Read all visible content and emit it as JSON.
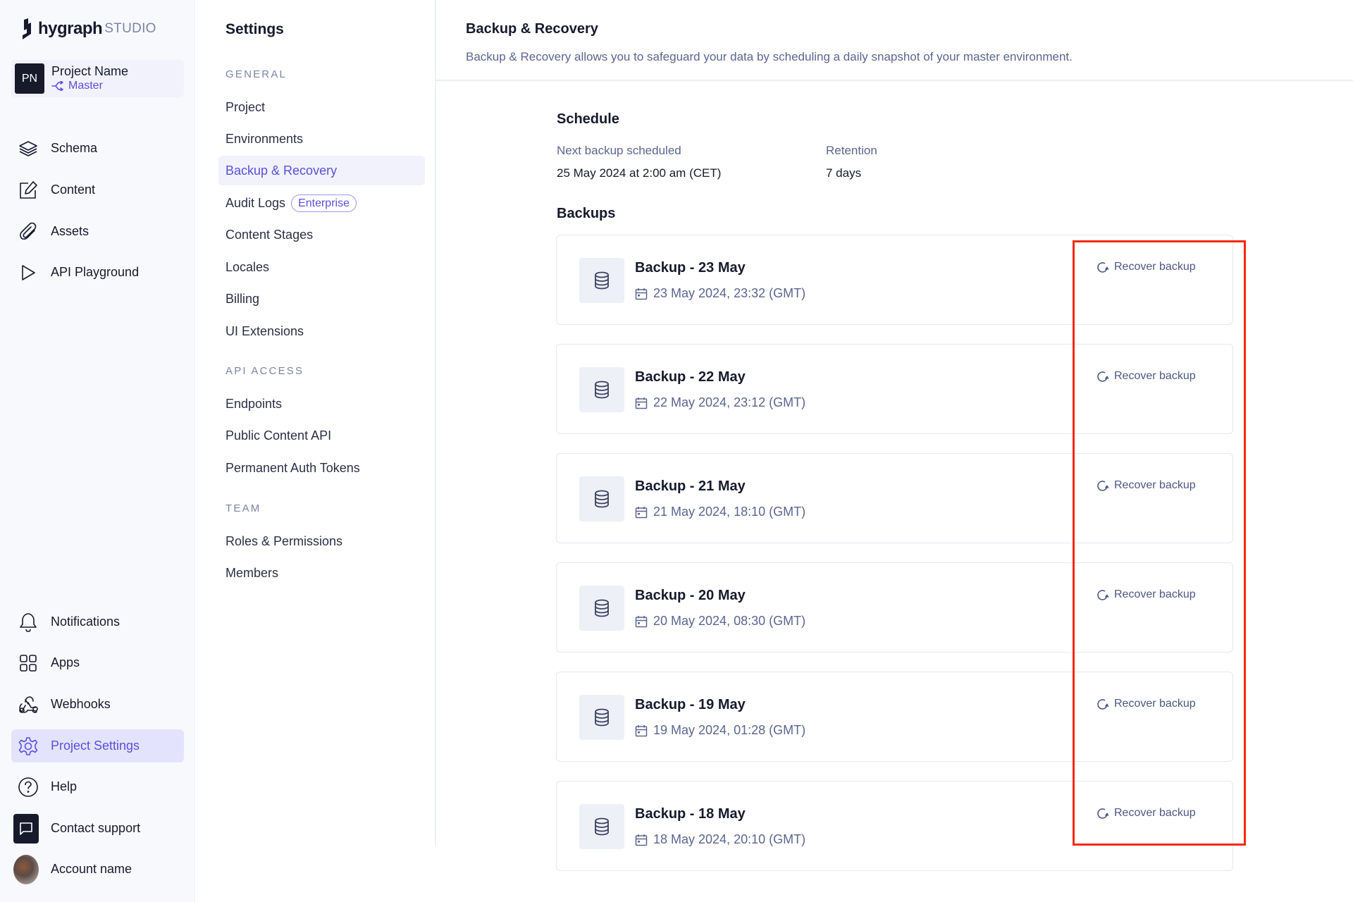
{
  "app": {
    "logo_word": "hygraph",
    "logo_suffix": "STUDIO",
    "accent_color": "#5b4fd9",
    "highlight_color": "#f5290d"
  },
  "project": {
    "initials": "PN",
    "name": "Project Name",
    "environment": "Master",
    "environment_icon": "branch-icon"
  },
  "sidebar": {
    "top_items": [
      {
        "label": "Schema",
        "icon": "layers-icon"
      },
      {
        "label": "Content",
        "icon": "edit-icon"
      },
      {
        "label": "Assets",
        "icon": "paperclip-icon"
      },
      {
        "label": "API Playground",
        "icon": "play-icon"
      }
    ],
    "bottom_items": [
      {
        "label": "Notifications",
        "icon": "bell-icon"
      },
      {
        "label": "Apps",
        "icon": "apps-grid-icon"
      },
      {
        "label": "Webhooks",
        "icon": "webhook-icon"
      },
      {
        "label": "Project Settings",
        "icon": "gear-icon",
        "active": true
      },
      {
        "label": "Help",
        "icon": "help-circle-icon"
      },
      {
        "label": "Contact support",
        "icon": "chat-icon"
      },
      {
        "label": "Account name",
        "icon": "avatar"
      }
    ]
  },
  "settings": {
    "title": "Settings",
    "sections": [
      {
        "label": "GENERAL",
        "items": [
          {
            "label": "Project"
          },
          {
            "label": "Environments"
          },
          {
            "label": "Backup & Recovery",
            "active": true
          },
          {
            "label": "Audit Logs",
            "badge": "Enterprise"
          },
          {
            "label": "Content Stages"
          },
          {
            "label": "Locales"
          },
          {
            "label": "Billing"
          },
          {
            "label": "UI Extensions"
          }
        ]
      },
      {
        "label": "API ACCESS",
        "items": [
          {
            "label": "Endpoints"
          },
          {
            "label": "Public Content API"
          },
          {
            "label": "Permanent Auth Tokens"
          }
        ]
      },
      {
        "label": "TEAM",
        "items": [
          {
            "label": "Roles & Permissions"
          },
          {
            "label": "Members"
          }
        ]
      }
    ]
  },
  "page": {
    "title": "Backup & Recovery",
    "description": "Backup & Recovery allows you to safeguard your data by scheduling a daily snapshot of your master environment."
  },
  "schedule": {
    "heading": "Schedule",
    "next_label": "Next backup scheduled",
    "next_value": "25 May 2024 at 2:00 am (CET)",
    "retention_label": "Retention",
    "retention_value": "7 days"
  },
  "backups": {
    "heading": "Backups",
    "action_label": "Recover backup",
    "items": [
      {
        "title": "Backup - 23 May",
        "date": "23 May 2024, 23:32 (GMT)"
      },
      {
        "title": "Backup - 22 May",
        "date": "22 May 2024, 23:12 (GMT)"
      },
      {
        "title": "Backup - 21 May",
        "date": "21 May 2024, 18:10 (GMT)"
      },
      {
        "title": "Backup - 20 May",
        "date": "20 May 2024, 08:30 (GMT)"
      },
      {
        "title": "Backup - 19 May",
        "date": "19 May 2024, 01:28 (GMT)"
      },
      {
        "title": "Backup - 18 May",
        "date": "18 May 2024, 20:10 (GMT)"
      }
    ]
  }
}
